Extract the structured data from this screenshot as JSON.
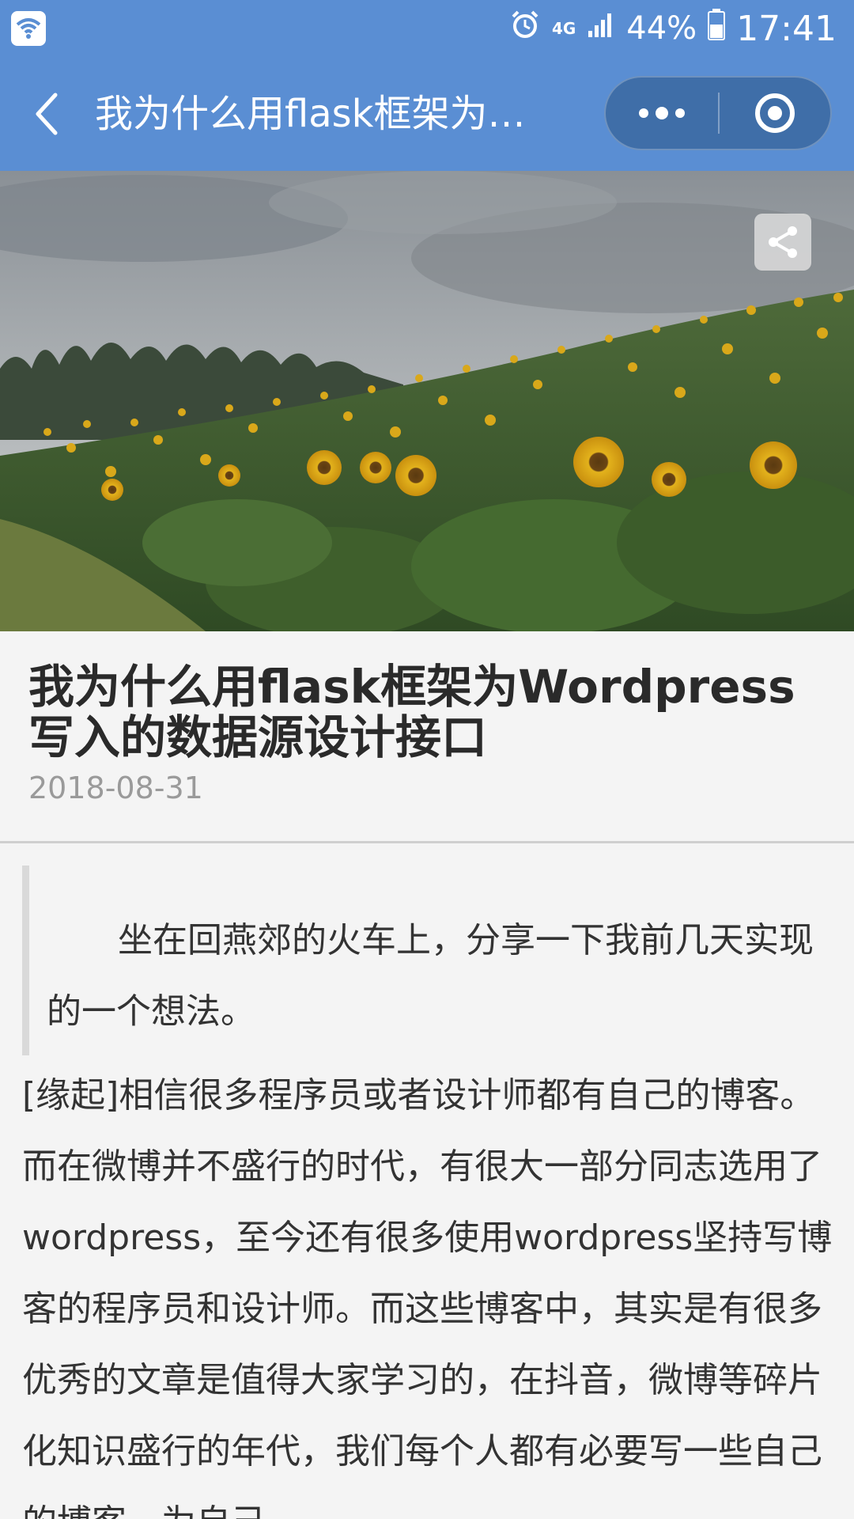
{
  "status_bar": {
    "network": "4G",
    "battery": "44%",
    "time": "17:41"
  },
  "nav": {
    "title": "我为什么用flask框架为W..."
  },
  "article": {
    "title": "我为什么用flask框架为Wordpress写入的数据源设计接口",
    "date": "2018-08-31",
    "quote": "坐在回燕郊的火车上，分享一下我前几天实现的一个想法。",
    "body": "[缘起]相信很多程序员或者设计师都有自己的博客。而在微博并不盛行的时代，有很大一部分同志选用了wordpress，至今还有很多使用wordpress坚持写博客的程序员和设计师。而这些博客中，其实是有很多优秀的文章是值得大家学习的，在抖音，微博等碎片化知识盛行的年代，我们每个人都有必要写一些自己的博客，为自己"
  },
  "colors": {
    "nav_bg": "#5a8ed3",
    "capsule_bg": "#3f6ea8",
    "page_bg": "#f4f4f4"
  }
}
